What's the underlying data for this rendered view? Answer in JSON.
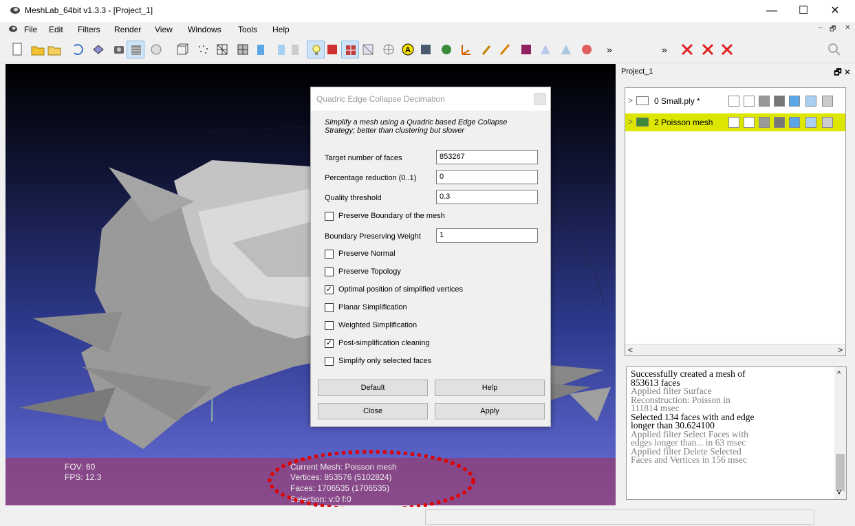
{
  "window": {
    "title": "MeshLab_64bit v1.3.3 - [Project_1]",
    "minimize": "—",
    "maximize": "☐",
    "close": "✕"
  },
  "menu": {
    "items": [
      "File",
      "Edit",
      "Filters",
      "Render",
      "View",
      "Windows",
      "Tools",
      "Help"
    ],
    "mdi_min": "–",
    "mdi_restore": "🗗",
    "mdi_close": "✕"
  },
  "viewport": {
    "fov": "FOV: 60",
    "fps": "FPS:  12.3",
    "current_mesh": "Current Mesh: Poisson mesh",
    "vertices": "Vertices: 853576 (5102824)",
    "faces": "Faces: 1706535 (1706535)",
    "selection": "Selection: v:0 f:0"
  },
  "dialog": {
    "title": "Quadric Edge Collapse Decimation",
    "description": "Simplify a mesh using a Quadric based Edge Collapse Strategy; better than clustering but slower",
    "fields": [
      {
        "label": "Target number of faces",
        "value": "853267"
      },
      {
        "label": "Percentage reduction (0..1)",
        "value": "0"
      },
      {
        "label": "Quality threshold",
        "value": "0.3"
      },
      {
        "label": "Boundary Preserving Weight",
        "value": "1"
      }
    ],
    "checkboxes": [
      {
        "label": "Preserve Boundary of the mesh",
        "checked": false
      },
      {
        "label": "Preserve Normal",
        "checked": false
      },
      {
        "label": "Preserve Topology",
        "checked": false
      },
      {
        "label": "Optimal position of simplified vertices",
        "checked": true
      },
      {
        "label": "Planar Simplification",
        "checked": false
      },
      {
        "label": "Weighted Simplification",
        "checked": false
      },
      {
        "label": "Post-simplification cleaning",
        "checked": true
      },
      {
        "label": "Simplify only selected faces",
        "checked": false
      }
    ],
    "checkmark": "✓",
    "buttons": {
      "default": "Default",
      "help": "Help",
      "close": "Close",
      "apply": "Apply"
    }
  },
  "project": {
    "title": "Project_1",
    "float_icon": "🗗 ✕",
    "layers": [
      {
        "id": "0",
        "name": "0 Small.ply *",
        "selected": false
      },
      {
        "id": "2",
        "name": "2 Poisson mesh",
        "selected": true
      }
    ],
    "scroll_left": "<",
    "scroll_right": ">"
  },
  "log": {
    "lines": [
      {
        "text": "Successfully created a mesh of",
        "color": "#000000"
      },
      {
        "text": "853613 faces",
        "color": "#000000"
      },
      {
        "text": "Applied filter Surface",
        "color": "#808080"
      },
      {
        "text": "Reconstruction: Poisson in",
        "color": "#808080"
      },
      {
        "text": "111814 msec",
        "color": "#808080"
      },
      {
        "text": "Selected 134 faces with and edge",
        "color": "#000000"
      },
      {
        "text": "longer than 30.624100",
        "color": "#000000"
      },
      {
        "text": "Applied filter Select Faces with",
        "color": "#808080"
      },
      {
        "text": "edges longer than... in 63 msec",
        "color": "#808080"
      },
      {
        "text": "Applied filter Delete Selected",
        "color": "#808080"
      },
      {
        "text": "Faces and Vertices in 156 msec",
        "color": "#808080"
      }
    ],
    "scroll_up": "^",
    "scroll_down": "v"
  },
  "toolbar": {
    "icons": [
      "new-project-icon",
      "open-project-icon",
      "open-mesh-icon",
      "reload-icon",
      "save-icon",
      "snapshot-icon",
      "layers-icon",
      "render-mode-icon",
      "bounding-box-icon",
      "points-icon",
      "wireframe-icon",
      "hidden-lines-icon",
      "flat-lines-icon",
      "flat-icon",
      "smooth-icon",
      "texture-icon",
      "light-icon",
      "double-side-icon",
      "fancy-light-icon",
      "trackball-icon",
      "annotate-icon",
      "measure-icon",
      "paint-icon",
      "align-icon",
      "manipulator-icon",
      "paint-brush-icon",
      "pick-points-icon",
      "pdf-icon",
      "selection-tool-icon",
      "select-vertices-icon",
      "vertex-color-icon",
      "more-icon",
      "delete-faces-icon",
      "delete-vertices-icon",
      "delete-faces-vertices-icon",
      "search-icon"
    ]
  }
}
